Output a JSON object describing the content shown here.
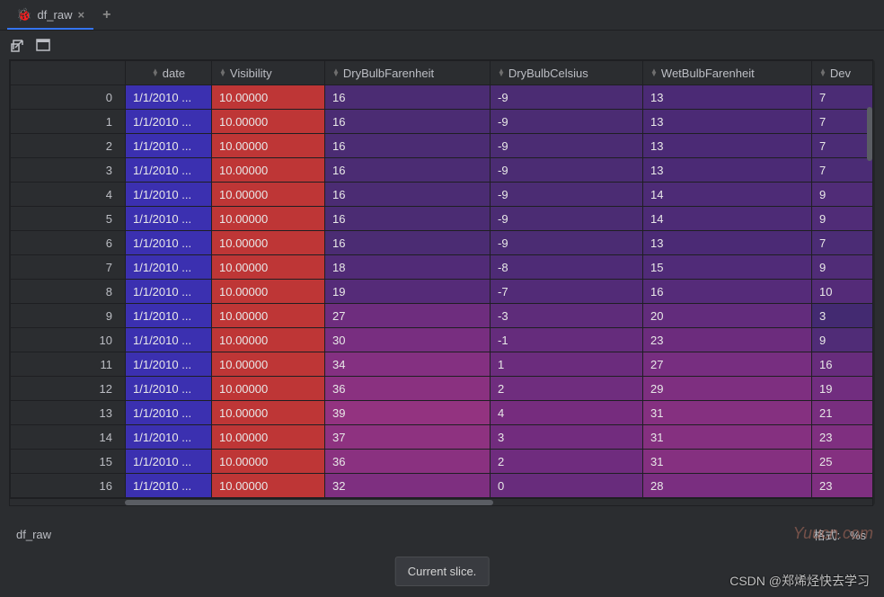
{
  "tabs": {
    "active": "df_raw",
    "add_icon": "+"
  },
  "table": {
    "headers": [
      "date",
      "Visibility",
      "DryBulbFarenheit",
      "DryBulbCelsius",
      "WetBulbFarenheit",
      "Dev"
    ],
    "rows": [
      {
        "idx": "0",
        "date": "1/1/2010 ...",
        "vis": "10.00000",
        "dbf": "16",
        "dbc": "-9",
        "wbf": "13",
        "dev": "7",
        "dbfc": "#4b2c73",
        "dbcc": "#4b2c73",
        "wbfc": "#4b2a75",
        "devc": "#4b2c75"
      },
      {
        "idx": "1",
        "date": "1/1/2010 ...",
        "vis": "10.00000",
        "dbf": "16",
        "dbc": "-9",
        "wbf": "13",
        "dev": "7",
        "dbfc": "#4b2c73",
        "dbcc": "#4b2c73",
        "wbfc": "#4b2a75",
        "devc": "#4b2c75"
      },
      {
        "idx": "2",
        "date": "1/1/2010 ...",
        "vis": "10.00000",
        "dbf": "16",
        "dbc": "-9",
        "wbf": "13",
        "dev": "7",
        "dbfc": "#4b2c73",
        "dbcc": "#4b2c73",
        "wbfc": "#4b2a75",
        "devc": "#4b2c75"
      },
      {
        "idx": "3",
        "date": "1/1/2010 ...",
        "vis": "10.00000",
        "dbf": "16",
        "dbc": "-9",
        "wbf": "13",
        "dev": "7",
        "dbfc": "#4b2c73",
        "dbcc": "#4b2c73",
        "wbfc": "#4b2a75",
        "devc": "#4b2c75"
      },
      {
        "idx": "4",
        "date": "1/1/2010 ...",
        "vis": "10.00000",
        "dbf": "16",
        "dbc": "-9",
        "wbf": "14",
        "dev": "9",
        "dbfc": "#4b2c73",
        "dbcc": "#4b2c73",
        "wbfc": "#4d2b76",
        "devc": "#502c77"
      },
      {
        "idx": "5",
        "date": "1/1/2010 ...",
        "vis": "10.00000",
        "dbf": "16",
        "dbc": "-9",
        "wbf": "14",
        "dev": "9",
        "dbfc": "#4b2c73",
        "dbcc": "#4b2c73",
        "wbfc": "#4d2b76",
        "devc": "#502c77"
      },
      {
        "idx": "6",
        "date": "1/1/2010 ...",
        "vis": "10.00000",
        "dbf": "16",
        "dbc": "-9",
        "wbf": "13",
        "dev": "7",
        "dbfc": "#4b2c73",
        "dbcc": "#4b2c73",
        "wbfc": "#4b2a75",
        "devc": "#4b2c75"
      },
      {
        "idx": "7",
        "date": "1/1/2010 ...",
        "vis": "10.00000",
        "dbf": "18",
        "dbc": "-8",
        "wbf": "15",
        "dev": "9",
        "dbfc": "#512b77",
        "dbcc": "#4e2b76",
        "wbfc": "#502b78",
        "devc": "#502c77"
      },
      {
        "idx": "8",
        "date": "1/1/2010 ...",
        "vis": "10.00000",
        "dbf": "19",
        "dbc": "-7",
        "wbf": "16",
        "dev": "10",
        "dbfc": "#552b78",
        "dbcc": "#522b77",
        "wbfc": "#552b79",
        "devc": "#542b78"
      },
      {
        "idx": "9",
        "date": "1/1/2010 ...",
        "vis": "10.00000",
        "dbf": "27",
        "dbc": "-3",
        "wbf": "20",
        "dev": "3",
        "dbfc": "#6e2d7e",
        "dbcc": "#5e2c7a",
        "wbfc": "#622c7c",
        "devc": "#432a71"
      },
      {
        "idx": "10",
        "date": "1/1/2010 ...",
        "vis": "10.00000",
        "dbf": "30",
        "dbc": "-1",
        "wbf": "23",
        "dev": "9",
        "dbfc": "#782e80",
        "dbcc": "#652c7c",
        "wbfc": "#6c2c7d",
        "devc": "#502c77"
      },
      {
        "idx": "11",
        "date": "1/1/2010 ...",
        "vis": "10.00000",
        "dbf": "34",
        "dbc": "1",
        "wbf": "27",
        "dev": "16",
        "dbfc": "#843081",
        "dbcc": "#6b2c7d",
        "wbfc": "#772e80",
        "devc": "#672c7c"
      },
      {
        "idx": "12",
        "date": "1/1/2010 ...",
        "vis": "10.00000",
        "dbf": "36",
        "dbc": "2",
        "wbf": "29",
        "dev": "19",
        "dbfc": "#8a3180",
        "dbcc": "#6f2d7e",
        "wbfc": "#7e2f80",
        "devc": "#712d7f"
      },
      {
        "idx": "13",
        "date": "1/1/2010 ...",
        "vis": "10.00000",
        "dbf": "39",
        "dbc": "4",
        "wbf": "31",
        "dev": "21",
        "dbfc": "#933380",
        "dbcc": "#762c7e",
        "wbfc": "#853080",
        "devc": "#782e7f"
      },
      {
        "idx": "14",
        "date": "1/1/2010 ...",
        "vis": "10.00000",
        "dbf": "37",
        "dbc": "3",
        "wbf": "31",
        "dev": "23",
        "dbfc": "#8e3280",
        "dbcc": "#722c7e",
        "wbfc": "#853080",
        "devc": "#7f2f80"
      },
      {
        "idx": "15",
        "date": "1/1/2010 ...",
        "vis": "10.00000",
        "dbf": "36",
        "dbc": "2",
        "wbf": "31",
        "dev": "25",
        "dbfc": "#8a3180",
        "dbcc": "#6f2c7e",
        "wbfc": "#853080",
        "devc": "#843080"
      },
      {
        "idx": "16",
        "date": "1/1/2010 ...",
        "vis": "10.00000",
        "dbf": "32",
        "dbc": "0",
        "wbf": "28",
        "dev": "23",
        "dbfc": "#7e2f80",
        "dbcc": "#682c7c",
        "wbfc": "#7a2e80",
        "devc": "#7f2f80"
      }
    ],
    "date_color": "#3b30b0",
    "vis_color": "#be3636"
  },
  "status": {
    "left": "df_raw",
    "format_label": "格式:",
    "format_value": "%s"
  },
  "tooltip": "Current slice.",
  "watermark_site": "Yuucn.com",
  "watermark_author": "CSDN @郑烯烃快去学习"
}
